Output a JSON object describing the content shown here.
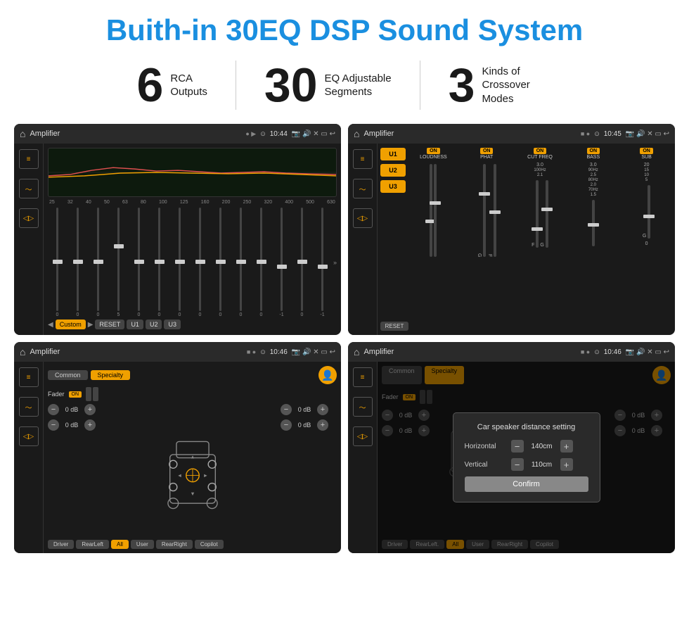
{
  "title": "Buith-in 30EQ DSP Sound System",
  "stats": [
    {
      "number": "6",
      "label": "RCA\nOutputs"
    },
    {
      "number": "30",
      "label": "EQ Adjustable\nSegments"
    },
    {
      "number": "3",
      "label": "Kinds of\nCrossover Modes"
    }
  ],
  "screens": {
    "eq1": {
      "title": "Amplifier",
      "time": "10:44",
      "freqs": [
        "25",
        "32",
        "40",
        "50",
        "63",
        "80",
        "100",
        "125",
        "160",
        "200",
        "250",
        "320",
        "400",
        "500",
        "630"
      ],
      "values": [
        "0",
        "0",
        "0",
        "5",
        "0",
        "0",
        "0",
        "0",
        "0",
        "0",
        "0",
        "-1",
        "0",
        "-1"
      ],
      "presets": [
        "Custom",
        "RESET",
        "U1",
        "U2",
        "U3"
      ]
    },
    "eq2": {
      "title": "Amplifier",
      "time": "10:45",
      "channels": [
        "LOUDNESS",
        "PHAT",
        "CUT FREQ",
        "BASS",
        "SUB"
      ],
      "presets": [
        "U1",
        "U2",
        "U3"
      ],
      "resetLabel": "RESET"
    },
    "crossover": {
      "title": "Amplifier",
      "time": "10:46",
      "tabs": [
        "Common",
        "Specialty"
      ],
      "faderLabel": "Fader",
      "faderOn": "ON",
      "db_values": [
        "0 dB",
        "0 dB",
        "0 dB",
        "0 dB"
      ],
      "buttons": [
        "Driver",
        "RearLeft",
        "All",
        "User",
        "RearRight",
        "Copilot"
      ]
    },
    "distance": {
      "title": "Amplifier",
      "time": "10:46",
      "tabs": [
        "Common",
        "Specialty"
      ],
      "dialog": {
        "title": "Car speaker distance setting",
        "horizontal_label": "Horizontal",
        "horizontal_value": "140cm",
        "vertical_label": "Vertical",
        "vertical_value": "110cm",
        "confirm_label": "Confirm"
      },
      "db_values": [
        "0 dB",
        "0 dB"
      ],
      "buttons": [
        "Driver",
        "RearLeft.",
        "All",
        "User",
        "RearRight",
        "Copilot"
      ]
    }
  },
  "colors": {
    "accent": "#1a8fe0",
    "orange": "#f0a000",
    "dark_bg": "#1a1a1a",
    "screen_bg": "#222"
  }
}
